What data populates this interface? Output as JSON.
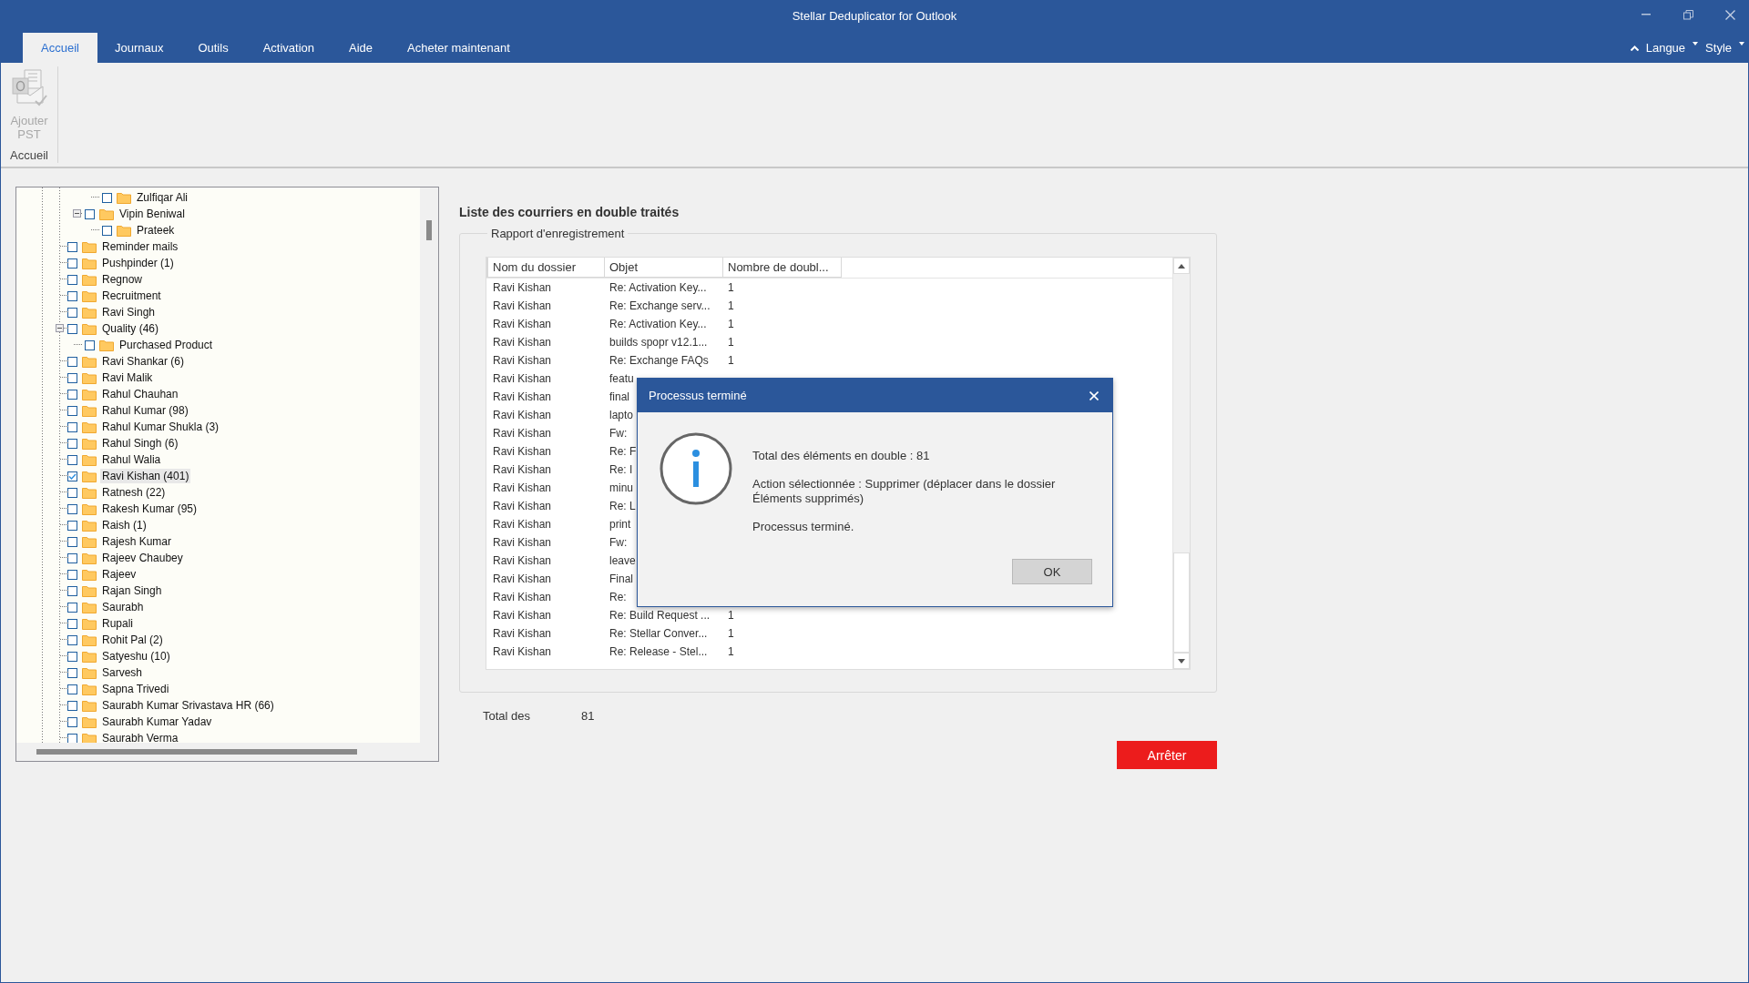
{
  "window": {
    "title": "Stellar Deduplicator for Outlook"
  },
  "menu_tabs": [
    {
      "label": "Accueil",
      "selected": true
    },
    {
      "label": "Journaux",
      "selected": false
    },
    {
      "label": "Outils",
      "selected": false
    },
    {
      "label": "Activation",
      "selected": false
    },
    {
      "label": "Aide",
      "selected": false
    },
    {
      "label": "Acheter maintenant",
      "selected": false
    }
  ],
  "right_menus": [
    {
      "label": "Langue"
    },
    {
      "label": "Style"
    }
  ],
  "ribbon": {
    "button": {
      "label": "Ajouter PST",
      "disabled": true
    },
    "group": "Accueil"
  },
  "tree": {
    "items": [
      {
        "children": [
          {
            "children": [
              {
                "label": "Zulfiqar Ali",
                "checked": false,
                "selected": false
              }
            ]
          },
          {
            "label": "Vipin Beniwal",
            "checked": false,
            "selected": false,
            "expanded": true,
            "children": [
              {
                "label": "Prateek",
                "checked": false,
                "selected": false
              }
            ]
          }
        ]
      },
      {
        "label": "Reminder mails",
        "checked": false,
        "selected": false
      },
      {
        "label": "Pushpinder (1)",
        "checked": false,
        "selected": false
      },
      {
        "label": "Regnow",
        "checked": false,
        "selected": false
      },
      {
        "label": "Recruitment",
        "checked": false,
        "selected": false
      },
      {
        "label": "Ravi Singh",
        "checked": false,
        "selected": false
      },
      {
        "label": "Quality (46)",
        "checked": false,
        "selected": false,
        "expanded": true,
        "children": [
          {
            "label": "Purchased Product",
            "checked": false,
            "selected": false
          }
        ]
      },
      {
        "label": "Ravi Shankar (6)",
        "checked": false,
        "selected": false
      },
      {
        "label": "Ravi Malik",
        "checked": false,
        "selected": false
      },
      {
        "label": "Rahul Chauhan",
        "checked": false,
        "selected": false
      },
      {
        "label": "Rahul Kumar (98)",
        "checked": false,
        "selected": false
      },
      {
        "label": "Rahul Kumar Shukla (3)",
        "checked": false,
        "selected": false
      },
      {
        "label": "Rahul Singh (6)",
        "checked": false,
        "selected": false
      },
      {
        "label": "Rahul Walia",
        "checked": false,
        "selected": false
      },
      {
        "label": "Ravi Kishan (401)",
        "checked": true,
        "selected": true
      },
      {
        "label": "Ratnesh (22)",
        "checked": false,
        "selected": false
      },
      {
        "label": "Rakesh Kumar (95)",
        "checked": false,
        "selected": false
      },
      {
        "label": "Raish (1)",
        "checked": false,
        "selected": false
      },
      {
        "label": "Rajesh Kumar",
        "checked": false,
        "selected": false
      },
      {
        "label": "Rajeev Chaubey",
        "checked": false,
        "selected": false
      },
      {
        "label": "Rajeev",
        "checked": false,
        "selected": false
      },
      {
        "label": "Rajan Singh",
        "checked": false,
        "selected": false
      },
      {
        "label": "Saurabh",
        "checked": false,
        "selected": false
      },
      {
        "label": "Rupali",
        "checked": false,
        "selected": false
      },
      {
        "label": "Rohit Pal (2)",
        "checked": false,
        "selected": false
      },
      {
        "label": "Satyeshu (10)",
        "checked": false,
        "selected": false
      },
      {
        "label": "Sarvesh",
        "checked": false,
        "selected": false
      },
      {
        "label": "Sapna Trivedi",
        "checked": false,
        "selected": false
      },
      {
        "label": "Saurabh Kumar Srivastava HR (66)",
        "checked": false,
        "selected": false
      },
      {
        "label": "Saurabh Kumar Yadav",
        "checked": false,
        "selected": false
      },
      {
        "label": "Saurabh Verma",
        "checked": false,
        "selected": false
      }
    ]
  },
  "report": {
    "heading": "Liste des courriers en double traités",
    "group_title": "Rapport d'enregistrement",
    "columns": [
      "Nom du dossier",
      "Objet",
      "Nombre de doubl..."
    ],
    "rows": [
      [
        "Ravi Kishan",
        "Re: Activation Key...",
        "1"
      ],
      [
        "Ravi Kishan",
        "Re: Exchange serv...",
        "1"
      ],
      [
        "Ravi Kishan",
        "Re: Activation Key...",
        "1"
      ],
      [
        "Ravi Kishan",
        "builds spopr v12.1...",
        "1"
      ],
      [
        "Ravi Kishan",
        "Re: Exchange FAQs",
        "1"
      ],
      [
        "Ravi Kishan",
        "featu"
      ],
      [
        "Ravi Kishan",
        "final"
      ],
      [
        "Ravi Kishan",
        "lapto"
      ],
      [
        "Ravi Kishan",
        "Fw:"
      ],
      [
        "Ravi Kishan",
        "Re: F"
      ],
      [
        "Ravi Kishan",
        "Re: I"
      ],
      [
        "Ravi Kishan",
        "minu"
      ],
      [
        "Ravi Kishan",
        "Re: L"
      ],
      [
        "Ravi Kishan",
        "print"
      ],
      [
        "Ravi Kishan",
        "Fw:"
      ],
      [
        "Ravi Kishan",
        "leave"
      ],
      [
        "Ravi Kishan",
        "Final"
      ],
      [
        "Ravi Kishan",
        "Re:"
      ],
      [
        "Ravi Kishan",
        "Re: Build Request ...",
        "1"
      ],
      [
        "Ravi Kishan",
        "Re: Stellar Conver...",
        "1"
      ],
      [
        "Ravi Kishan",
        "Re: Release - Stel...",
        "1"
      ]
    ],
    "total_label": "Total des",
    "total_value": "81",
    "stop_button": "Arrêter"
  },
  "dialog": {
    "title": "Processus terminé",
    "lines": [
      "Total des éléments en double : 81",
      "Action sélectionnée : Supprimer (déplacer dans le dossier Éléments supprimés)",
      "Processus terminé."
    ],
    "ok_button": "OK"
  }
}
